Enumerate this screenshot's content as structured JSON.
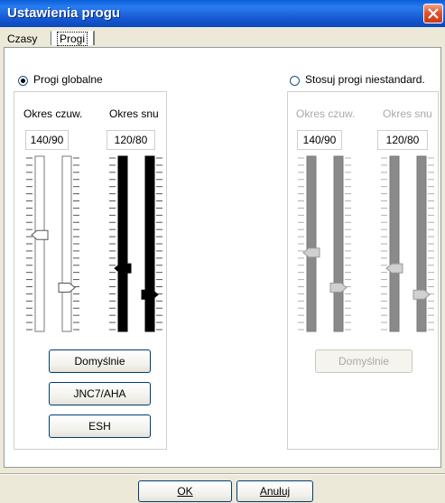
{
  "window": {
    "title": "Ustawienia progu"
  },
  "tabs": [
    {
      "label": "Czasy"
    },
    {
      "label": "Progi"
    }
  ],
  "global": {
    "radio_label": "Progi globalne",
    "col1": {
      "label": "Okres czuw.",
      "value": "140/90"
    },
    "col2": {
      "label": "Okres snu",
      "value": "120/80"
    },
    "buttons": {
      "default": "Domyślnie",
      "jnc7": "JNC7/AHA",
      "esh": "ESH"
    }
  },
  "custom": {
    "radio_label": "Stosuj progi niestandard.",
    "col1": {
      "label": "Okres czuw.",
      "value": "140/90"
    },
    "col2": {
      "label": "Okres snu",
      "value": "120/80"
    },
    "buttons": {
      "default": "Domyślnie"
    }
  },
  "footer": {
    "ok": "OK",
    "cancel": "Anuluj"
  },
  "sliders": {
    "global_wake_sys": 0.55,
    "global_wake_dia": 0.25,
    "global_sleep_sys": 0.36,
    "global_sleep_dia": 0.21,
    "custom_wake_sys": 0.45,
    "custom_wake_dia": 0.25,
    "custom_sleep_sys": 0.36,
    "custom_sleep_dia": 0.21
  }
}
